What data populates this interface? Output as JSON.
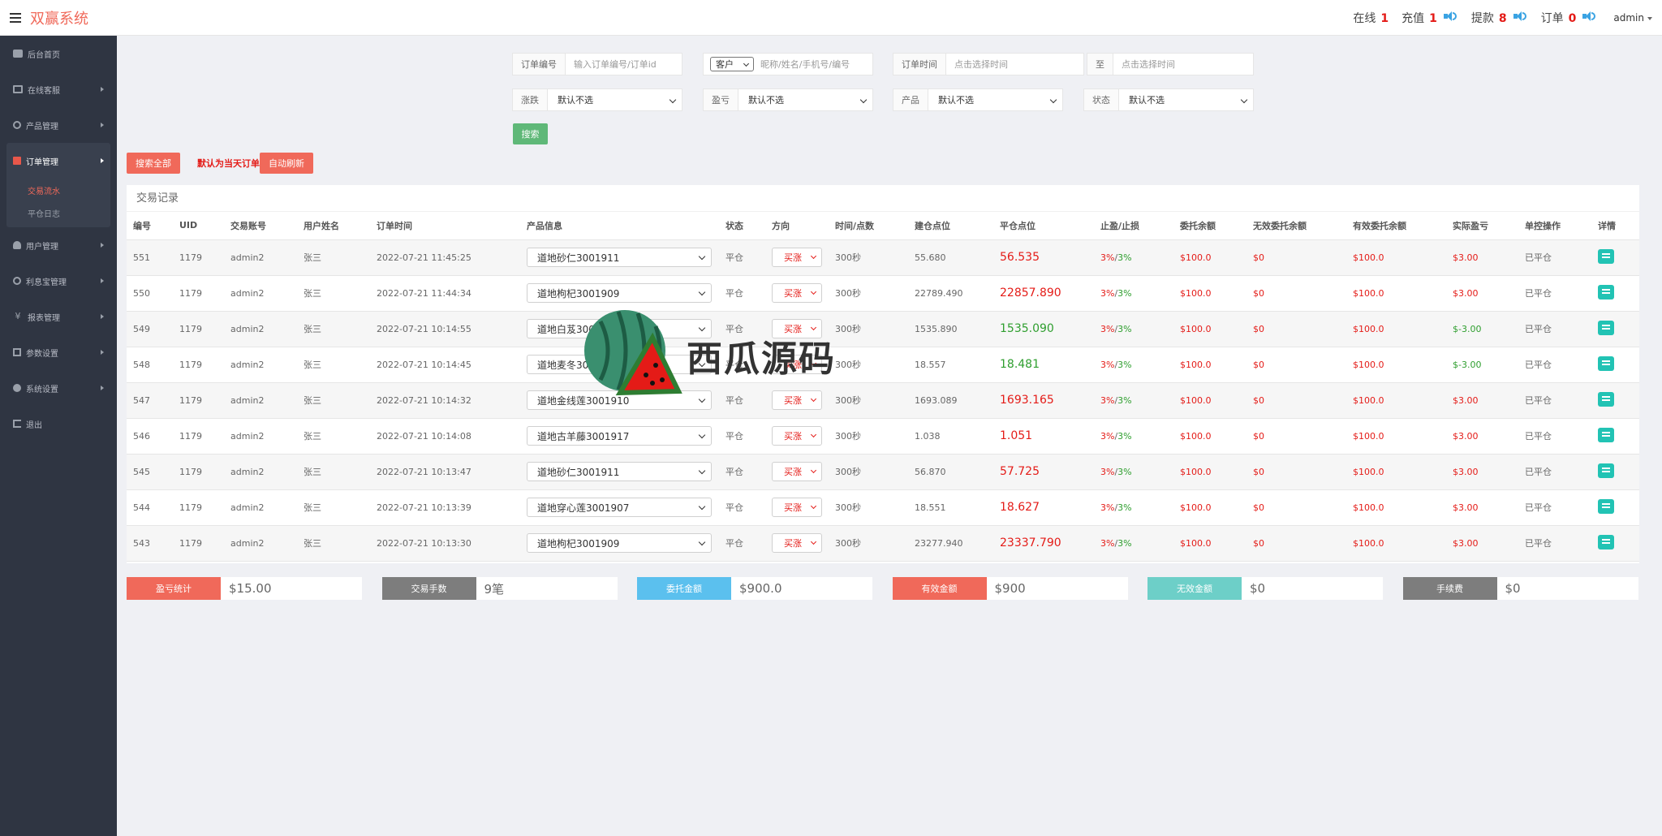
{
  "brand": "双赢系统",
  "header": {
    "stats": [
      {
        "label": "在线",
        "value": "1",
        "speaker": false
      },
      {
        "label": "充值",
        "value": "1",
        "speaker": true
      },
      {
        "label": "提款",
        "value": "8",
        "speaker": true
      },
      {
        "label": "订单",
        "value": "0",
        "speaker": true
      }
    ],
    "user": "admin"
  },
  "sidebar": {
    "items": [
      {
        "label": "后台首页",
        "icon": "home-icon"
      },
      {
        "label": "在线客服",
        "icon": "book-icon"
      },
      {
        "label": "产品管理",
        "icon": "bitcoin-icon"
      },
      {
        "label": "订单管理",
        "icon": "order-icon"
      },
      {
        "label": "用户管理",
        "icon": "user-icon"
      },
      {
        "label": "利息宝管理",
        "icon": "interest-icon"
      },
      {
        "label": "报表管理",
        "icon": "yen-icon"
      },
      {
        "label": "参数设置",
        "icon": "copy-icon"
      },
      {
        "label": "系统设置",
        "icon": "gears-icon"
      },
      {
        "label": "退出",
        "icon": "logout-icon"
      }
    ],
    "submenu": [
      "交易流水",
      "平仓日志"
    ]
  },
  "filters": {
    "order_no_label": "订单编号",
    "order_no_placeholder": "输入订单编号/订单id",
    "customer_select": "客户",
    "customer_placeholder": "昵称/姓名/手机号/编号",
    "order_time_label": "订单时间",
    "time_start_placeholder": "点击选择时间",
    "to_label": "至",
    "time_end_placeholder": "点击选择时间",
    "rise_fall_label": "涨跌",
    "rise_fall_value": "默认不选",
    "pnl_label": "盈亏",
    "pnl_value": "默认不选",
    "product_label": "产品",
    "product_value": "默认不选",
    "status_label": "状态",
    "status_value": "默认不选",
    "search_button": "搜索",
    "search_all_button": "搜索全部",
    "default_note": "默认为当天订单",
    "auto_refresh_button": "自动刷新"
  },
  "records": {
    "title": "交易记录",
    "columns": [
      "编号",
      "UID",
      "交易账号",
      "用户姓名",
      "订单时间",
      "产品信息",
      "状态",
      "方向",
      "时间/点数",
      "建仓点位",
      "平仓点位",
      "止盈/止损",
      "委托余额",
      "无效委托余额",
      "有效委托余额",
      "实际盈亏",
      "单控操作",
      "详情"
    ],
    "rows": [
      {
        "id": "551",
        "uid": "1179",
        "account": "admin2",
        "name": "张三",
        "time": "2022-07-21 11:45:25",
        "product": "道地砂仁3001911",
        "status": "平仓",
        "direction": "买涨",
        "duration": "300秒",
        "open": "55.680",
        "close": "56.535",
        "close_color": "red",
        "tp": "3%",
        "sl": "3%",
        "entrust": "$100.0",
        "invalid": "$0",
        "valid": "$100.0",
        "pnl": "$3.00",
        "pnl_color": "red",
        "ctrl": "已平仓"
      },
      {
        "id": "550",
        "uid": "1179",
        "account": "admin2",
        "name": "张三",
        "time": "2022-07-21 11:44:34",
        "product": "道地枸杞3001909",
        "status": "平仓",
        "direction": "买涨",
        "duration": "300秒",
        "open": "22789.490",
        "close": "22857.890",
        "close_color": "red",
        "tp": "3%",
        "sl": "3%",
        "entrust": "$100.0",
        "invalid": "$0",
        "valid": "$100.0",
        "pnl": "$3.00",
        "pnl_color": "red",
        "ctrl": "已平仓"
      },
      {
        "id": "549",
        "uid": "1179",
        "account": "admin2",
        "name": "张三",
        "time": "2022-07-21 10:14:55",
        "product": "道地白芨3001908",
        "status": "平仓",
        "direction": "买涨",
        "duration": "300秒",
        "open": "1535.890",
        "close": "1535.090",
        "close_color": "green",
        "tp": "3%",
        "sl": "3%",
        "entrust": "$100.0",
        "invalid": "$0",
        "valid": "$100.0",
        "pnl": "$-3.00",
        "pnl_color": "green",
        "ctrl": "已平仓"
      },
      {
        "id": "548",
        "uid": "1179",
        "account": "admin2",
        "name": "张三",
        "time": "2022-07-21 10:14:45",
        "product": "道地麦冬3001906",
        "status": "平仓",
        "direction": "买涨",
        "duration": "300秒",
        "open": "18.557",
        "close": "18.481",
        "close_color": "green",
        "tp": "3%",
        "sl": "3%",
        "entrust": "$100.0",
        "invalid": "$0",
        "valid": "$100.0",
        "pnl": "$-3.00",
        "pnl_color": "green",
        "ctrl": "已平仓"
      },
      {
        "id": "547",
        "uid": "1179",
        "account": "admin2",
        "name": "张三",
        "time": "2022-07-21 10:14:32",
        "product": "道地金线莲3001910",
        "status": "平仓",
        "direction": "买涨",
        "duration": "300秒",
        "open": "1693.089",
        "close": "1693.165",
        "close_color": "red",
        "tp": "3%",
        "sl": "3%",
        "entrust": "$100.0",
        "invalid": "$0",
        "valid": "$100.0",
        "pnl": "$3.00",
        "pnl_color": "red",
        "ctrl": "已平仓"
      },
      {
        "id": "546",
        "uid": "1179",
        "account": "admin2",
        "name": "张三",
        "time": "2022-07-21 10:14:08",
        "product": "道地古羊藤3001917",
        "status": "平仓",
        "direction": "买涨",
        "duration": "300秒",
        "open": "1.038",
        "close": "1.051",
        "close_color": "red",
        "tp": "3%",
        "sl": "3%",
        "entrust": "$100.0",
        "invalid": "$0",
        "valid": "$100.0",
        "pnl": "$3.00",
        "pnl_color": "red",
        "ctrl": "已平仓"
      },
      {
        "id": "545",
        "uid": "1179",
        "account": "admin2",
        "name": "张三",
        "time": "2022-07-21 10:13:47",
        "product": "道地砂仁3001911",
        "status": "平仓",
        "direction": "买涨",
        "duration": "300秒",
        "open": "56.870",
        "close": "57.725",
        "close_color": "red",
        "tp": "3%",
        "sl": "3%",
        "entrust": "$100.0",
        "invalid": "$0",
        "valid": "$100.0",
        "pnl": "$3.00",
        "pnl_color": "red",
        "ctrl": "已平仓"
      },
      {
        "id": "544",
        "uid": "1179",
        "account": "admin2",
        "name": "张三",
        "time": "2022-07-21 10:13:39",
        "product": "道地穿心莲3001907",
        "status": "平仓",
        "direction": "买涨",
        "duration": "300秒",
        "open": "18.551",
        "close": "18.627",
        "close_color": "red",
        "tp": "3%",
        "sl": "3%",
        "entrust": "$100.0",
        "invalid": "$0",
        "valid": "$100.0",
        "pnl": "$3.00",
        "pnl_color": "red",
        "ctrl": "已平仓"
      },
      {
        "id": "543",
        "uid": "1179",
        "account": "admin2",
        "name": "张三",
        "time": "2022-07-21 10:13:30",
        "product": "道地枸杞3001909",
        "status": "平仓",
        "direction": "买涨",
        "duration": "300秒",
        "open": "23277.940",
        "close": "23337.790",
        "close_color": "red",
        "tp": "3%",
        "sl": "3%",
        "entrust": "$100.0",
        "invalid": "$0",
        "valid": "$100.0",
        "pnl": "$3.00",
        "pnl_color": "red",
        "ctrl": "已平仓"
      }
    ]
  },
  "summary": [
    {
      "label": "盈亏统计",
      "value": "$15.00",
      "color": "#f0695a"
    },
    {
      "label": "交易手数",
      "value": "9笔",
      "color": "#7d7d7d"
    },
    {
      "label": "委托金额",
      "value": "$900.0",
      "color": "#5bc0ee"
    },
    {
      "label": "有效金额",
      "value": "$900",
      "color": "#f0695a"
    },
    {
      "label": "无效金额",
      "value": "$0",
      "color": "#6dcfc8"
    },
    {
      "label": "手续费",
      "value": "$0",
      "color": "#7d7d7d"
    }
  ],
  "watermark": "西瓜源码",
  "colors": {
    "accent": "#f0695a",
    "sidebar": "#2f3542",
    "green_button": "#5fb878",
    "teal_icon": "#22c3b4"
  }
}
